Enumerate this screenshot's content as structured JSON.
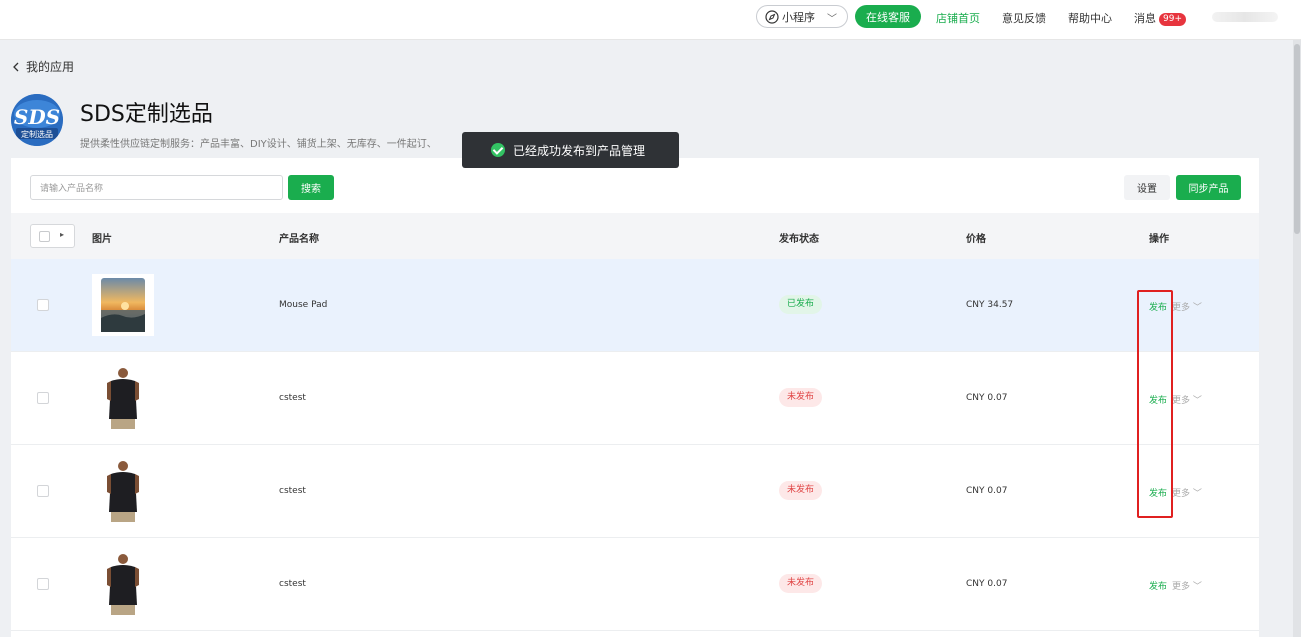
{
  "topbar": {
    "mini_program": "小程序",
    "online_service": "在线客服",
    "store_home": "店铺首页",
    "feedback": "意见反馈",
    "help": "帮助中心",
    "messages": "消息",
    "messages_badge": "99+"
  },
  "back_label": "我的应用",
  "app": {
    "logo_text": "SDS",
    "logo_subtext": "定制选品",
    "title": "SDS定制选品",
    "description": "提供柔性供应链定制服务：产品丰富、DIY设计、铺货上架、无库存、一件起订、"
  },
  "toast": {
    "message": "已经成功发布到产品管理"
  },
  "toolbar": {
    "search_placeholder": "请输入产品名称",
    "search_button": "搜索",
    "settings_button": "设置",
    "sync_button": "同步产品"
  },
  "table": {
    "headers": {
      "image": "图片",
      "name": "产品名称",
      "status": "发布状态",
      "price": "价格",
      "actions": "操作"
    },
    "rows": [
      {
        "name": "Mouse Pad",
        "status": "已发布",
        "price": "CNY 34.57",
        "action": "发布",
        "more": "更多"
      },
      {
        "name": "cstest",
        "status": "未发布",
        "price": "CNY 0.07",
        "action": "发布",
        "more": "更多"
      },
      {
        "name": "cstest",
        "status": "未发布",
        "price": "CNY 0.07",
        "action": "发布",
        "more": "更多"
      },
      {
        "name": "cstest",
        "status": "未发布",
        "price": "CNY 0.07",
        "action": "发布",
        "more": "更多"
      }
    ]
  },
  "colors": {
    "accent": "#1aad4e",
    "published_tag_bg": "#e2f5e8",
    "unpublished_tag_bg": "#fde8e8",
    "highlight_row": "#eaf2fd",
    "annotation": "#e02020"
  }
}
